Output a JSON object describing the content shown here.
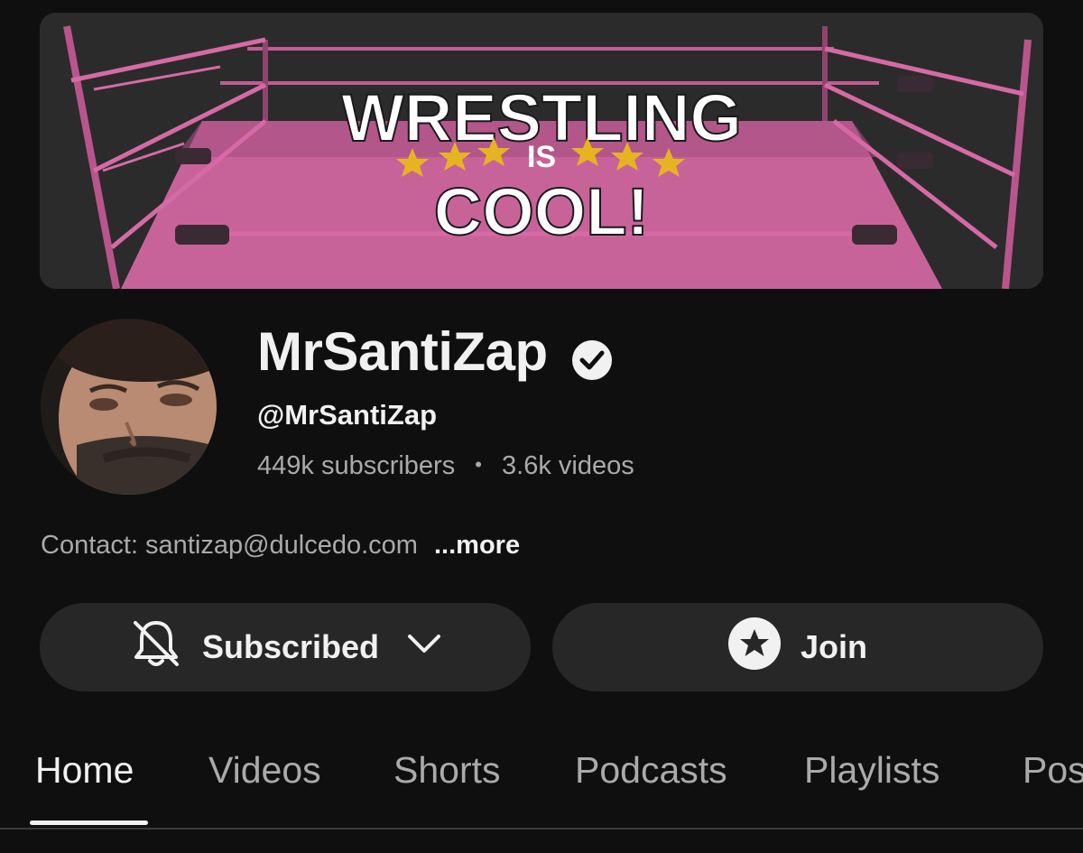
{
  "banner": {
    "line1": "WRESTLING",
    "line2": "IS",
    "line3": "COOL!"
  },
  "channel": {
    "name": "MrSantiZap",
    "handle": "@MrSantiZap",
    "subscribers": "449k subscribers",
    "separator": "•",
    "videos": "3.6k videos"
  },
  "description": {
    "text": "Contact: santizap@dulcedo.com",
    "more_label": "...more"
  },
  "actions": {
    "subscribed_label": "Subscribed",
    "join_label": "Join"
  },
  "tabs": [
    {
      "label": "Home"
    },
    {
      "label": "Videos"
    },
    {
      "label": "Shorts"
    },
    {
      "label": "Podcasts"
    },
    {
      "label": "Playlists"
    },
    {
      "label": "Pos"
    }
  ],
  "icons": {
    "verified": "verified-check-icon",
    "bell": "bell-off-icon",
    "chevron": "chevron-down-icon",
    "join": "star-icon"
  },
  "colors": {
    "background": "#0f0f0f",
    "button": "#272727",
    "ring_pink": "#d66aa6",
    "star_gold": "#e6b422"
  }
}
